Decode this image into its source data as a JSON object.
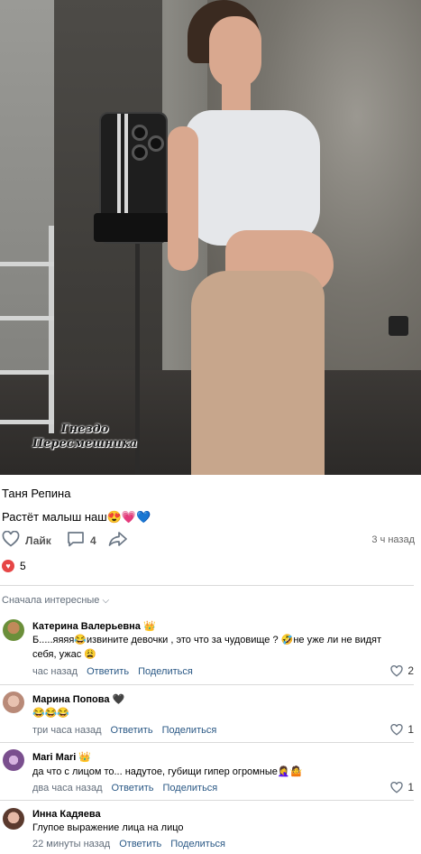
{
  "post": {
    "author": "Таня Репина",
    "text": "Растёт малыш наш😍💗💙",
    "like_label": "Лайк",
    "comment_count": "4",
    "time": "3 ч назад",
    "likes": "5",
    "watermark_line1": "Гнездо",
    "watermark_line2": "Пересмешника"
  },
  "sort": {
    "label": "Сначала интересные",
    "chevron": "⌵"
  },
  "comments": [
    {
      "name": "Катерина Валерьевна",
      "badge": "👑",
      "text_line1": "Б.....яяяя😂извините девочки , это что за чудовище ? 🤣не уже ли не видят",
      "text_line2": "себя, ужас 😩",
      "time": "час назад",
      "reply": "Ответить",
      "share": "Поделиться",
      "likes": "2"
    },
    {
      "name": "Марина Попова",
      "badge": "🖤",
      "text_line1": "😂😂😂",
      "time": "три часа назад",
      "reply": "Ответить",
      "share": "Поделиться",
      "likes": "1"
    },
    {
      "name": "Mari Mari",
      "badge": "👑",
      "text_line1": "да что с лицом то... надутое, губищи гипер огромные🤦‍♀️🤷",
      "time": "два часа назад",
      "reply": "Ответить",
      "share": "Поделиться",
      "likes": "1"
    },
    {
      "name": "Инна Кадяева",
      "text_line1": "Глупое выражение лица на лицо",
      "time": "22 минуты назад",
      "reply": "Ответить",
      "share": "Поделиться"
    }
  ],
  "colors": {
    "link": "#2a5885",
    "meta": "#626d7a",
    "heart": "#e64646"
  }
}
